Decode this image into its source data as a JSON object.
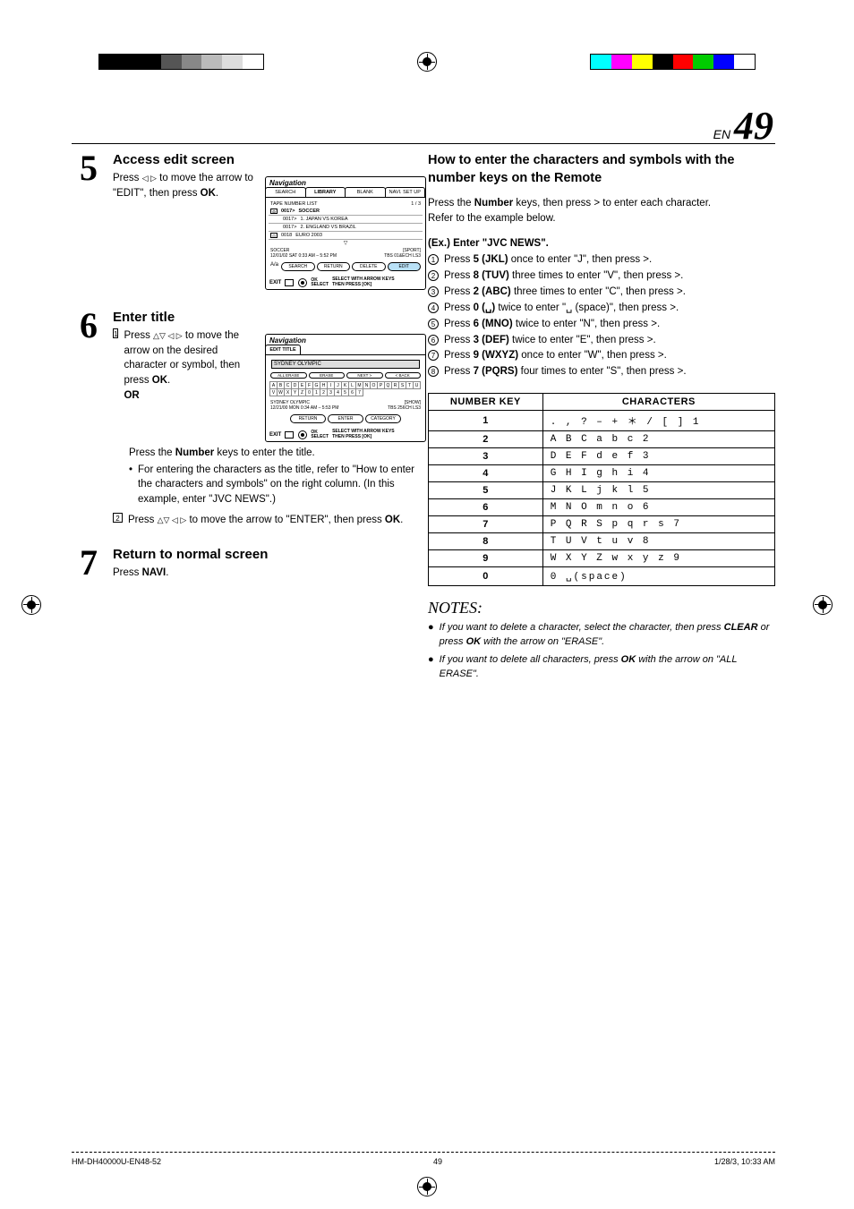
{
  "page": {
    "en": "EN",
    "number": "49"
  },
  "steps": {
    "s5": {
      "num": "5",
      "title": "Access edit screen",
      "body_pre": "Press ",
      "body_mid": " to move the arrow to \"EDIT\", then press ",
      "ok": "OK",
      "body_post": "."
    },
    "s6": {
      "num": "6",
      "title": "Enter title",
      "sub1": {
        "n": "1",
        "pre": "Press ",
        "mid": " to move the arrow on the desired character or symbol, then press ",
        "ok": "OK",
        "post": "."
      },
      "or": "OR",
      "press_number": "Press the ",
      "number_word": "Number",
      "press_number_post": " keys to enter the title.",
      "bullet": "For entering the characters as the title, refer to \"How to enter the characters and symbols\" on the right column. (In this example, enter \"JVC NEWS\".)",
      "sub2": {
        "n": "2",
        "pre": "Press ",
        "mid": " to move the arrow to \"ENTER\", then press ",
        "ok": "OK",
        "post": "."
      }
    },
    "s7": {
      "num": "7",
      "title": "Return to normal screen",
      "pre": "Press ",
      "navi": "NAVI",
      "post": "."
    }
  },
  "panel1": {
    "logo": "Navigation",
    "tabs": [
      "SEARCH",
      "LIBRARY",
      "BLANK",
      "NAVI. SET UP"
    ],
    "sub": "TAPE NUMBER LIST",
    "pg": "1 / 3",
    "lines": [
      {
        "num": "0017>",
        "title": "SOCCER",
        "bold": true
      },
      {
        "num": "0017>",
        "title": "1. JAPAN VS KOREA"
      },
      {
        "num": "0017>",
        "title": "2. ENGLAND VS BRAZIL"
      },
      {
        "num": "0018",
        "title": "EURO 2003"
      }
    ],
    "info_l": "SOCCER",
    "info_l2": "12/01/02 SAT  0:33 AM – 5:52 PM",
    "info_r": "[SPORT]",
    "info_r2": "TBS 01&ECH    LS3",
    "buttons": [
      "SEARCH",
      "RETURN",
      "DELETE",
      "EDIT"
    ],
    "exit": "EXIT",
    "footer_ok": "OK",
    "footer_sel": "SELECT",
    "footer_help1": "SELECT WITH ARROW KEYS",
    "footer_help2": "THEN PRESS [OK]"
  },
  "panel2": {
    "logo": "Navigation",
    "tab": "EDIT TITLE",
    "input": "SYDNEY OLYMPIC",
    "mini_buttons": [
      "ALL ERASE",
      "ERASE",
      "NEXT >",
      "< BACK"
    ],
    "info_l": "SYDNEY OLYMPIC",
    "info_l2": "12/21/00 MON  0:34 AM – 5:53 PM",
    "info_r": "[SHOW]",
    "info_r2": "TBS 256CH       LS3",
    "buttons": [
      "RETURN",
      "ENTER",
      "CATEGORY"
    ],
    "exit": "EXIT",
    "footer_ok": "OK",
    "footer_sel": "SELECT",
    "footer_help1": "SELECT WITH ARROW KEYS",
    "footer_help2": "THEN PRESS [OK]"
  },
  "right": {
    "heading": "How to enter the characters and symbols with the number keys on the Remote",
    "p1_pre": "Press the ",
    "p1_b": "Number",
    "p1_mid": " keys, then press > to enter each character.",
    "p2": "Refer to the example below.",
    "example_head": "(Ex.) Enter \"JVC NEWS\".",
    "ex": [
      {
        "n": "1",
        "pre": "Press ",
        "key": "5 (JKL)",
        "mid": " once to enter \"J\", then press >."
      },
      {
        "n": "2",
        "pre": "Press ",
        "key": "8 (TUV)",
        "mid": " three times to enter \"V\", then press >."
      },
      {
        "n": "3",
        "pre": "Press ",
        "key": "2 (ABC)",
        "mid": " three times to enter \"C\", then press >."
      },
      {
        "n": "4",
        "pre": "Press ",
        "key": "0 (␣)",
        "mid": " twice to enter \"␣ (space)\", then press >."
      },
      {
        "n": "5",
        "pre": "Press ",
        "key": "6 (MNO)",
        "mid": " twice to enter \"N\", then press >."
      },
      {
        "n": "6",
        "pre": "Press ",
        "key": "3 (DEF)",
        "mid": " twice to enter \"E\", then press >."
      },
      {
        "n": "7",
        "pre": "Press ",
        "key": "9 (WXYZ)",
        "mid": " once to enter \"W\", then press >."
      },
      {
        "n": "8",
        "pre": "Press ",
        "key": "7 (PQRS)",
        "mid": " four times to enter \"S\", then press >."
      }
    ],
    "table": {
      "h1": "NUMBER KEY",
      "h2": "CHARACTERS",
      "rows": [
        {
          "k": "1",
          "c": ". , ? – + ＊ / [ ] 1"
        },
        {
          "k": "2",
          "c": "A B C a b c 2"
        },
        {
          "k": "3",
          "c": "D E F d e f 3"
        },
        {
          "k": "4",
          "c": "G H I g h i 4"
        },
        {
          "k": "5",
          "c": "J K L j k l 5"
        },
        {
          "k": "6",
          "c": "M N O m n o 6"
        },
        {
          "k": "7",
          "c": "P Q R S p q r s 7"
        },
        {
          "k": "8",
          "c": "T U V t u v 8"
        },
        {
          "k": "9",
          "c": "W X Y Z w x y z 9"
        },
        {
          "k": "0",
          "c": "0 ␣(space)"
        }
      ]
    },
    "notes_head": "NOTES:",
    "notes": [
      {
        "pre": "If you want to delete a character, select the character, then press ",
        "b1": "CLEAR",
        "mid": " or press ",
        "b2": "OK",
        "post": " with the arrow on \"ERASE\"."
      },
      {
        "pre": "If you want to delete all characters, press ",
        "b1": "OK",
        "post": " with the arrow on \"ALL ERASE\"."
      }
    ]
  },
  "footer": {
    "left": "HM-DH40000U-EN48-52",
    "mid": "49",
    "right": "1/28/3, 10:33 AM"
  },
  "chart_data": {
    "type": "table",
    "title": "NUMBER KEY → CHARACTERS",
    "columns": [
      "NUMBER KEY",
      "CHARACTERS"
    ],
    "rows": [
      [
        "1",
        ". , ? – + * / [ ] 1"
      ],
      [
        "2",
        "A B C a b c 2"
      ],
      [
        "3",
        "D E F d e f 3"
      ],
      [
        "4",
        "G H I g h i 4"
      ],
      [
        "5",
        "J K L j k l 5"
      ],
      [
        "6",
        "M N O m n o 6"
      ],
      [
        "7",
        "P Q R S p q r s 7"
      ],
      [
        "8",
        "T U V t u v 8"
      ],
      [
        "9",
        "W X Y Z w x y z 9"
      ],
      [
        "0",
        "0  (space)"
      ]
    ]
  }
}
